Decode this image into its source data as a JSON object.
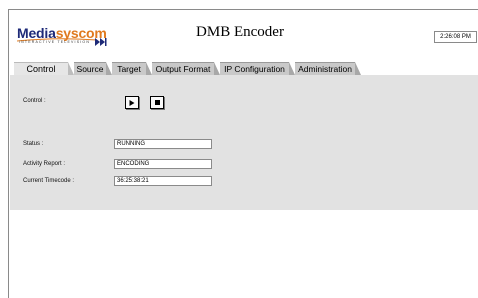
{
  "brand": {
    "logo_text_a": "Media",
    "logo_text_b": "syscom",
    "tagline": "INTERACTIVE TELEVISION"
  },
  "header": {
    "title": "DMB Encoder",
    "clock": "2:26:08 PM"
  },
  "tabs": [
    {
      "label": "Control",
      "active": true
    },
    {
      "label": "Source",
      "active": false
    },
    {
      "label": "Target",
      "active": false
    },
    {
      "label": "Output Format",
      "active": false
    },
    {
      "label": "IP Configuration",
      "active": false
    },
    {
      "label": "Administration",
      "active": false
    }
  ],
  "control": {
    "label": "Control :",
    "play_icon": "play-icon",
    "stop_icon": "stop-icon"
  },
  "status": {
    "status_label": "Status :",
    "status_value": "RUNNING",
    "activity_label": "Activity Report :",
    "activity_value": "ENCODING",
    "timecode_label": "Current Timecode :",
    "timecode_value": "36:25:38:21"
  },
  "colors": {
    "panel_bg": "#e2e2e2",
    "tab_bg": "#c9c9c9",
    "logo_blue": "#1e2a78",
    "logo_orange": "#e07a1f"
  }
}
